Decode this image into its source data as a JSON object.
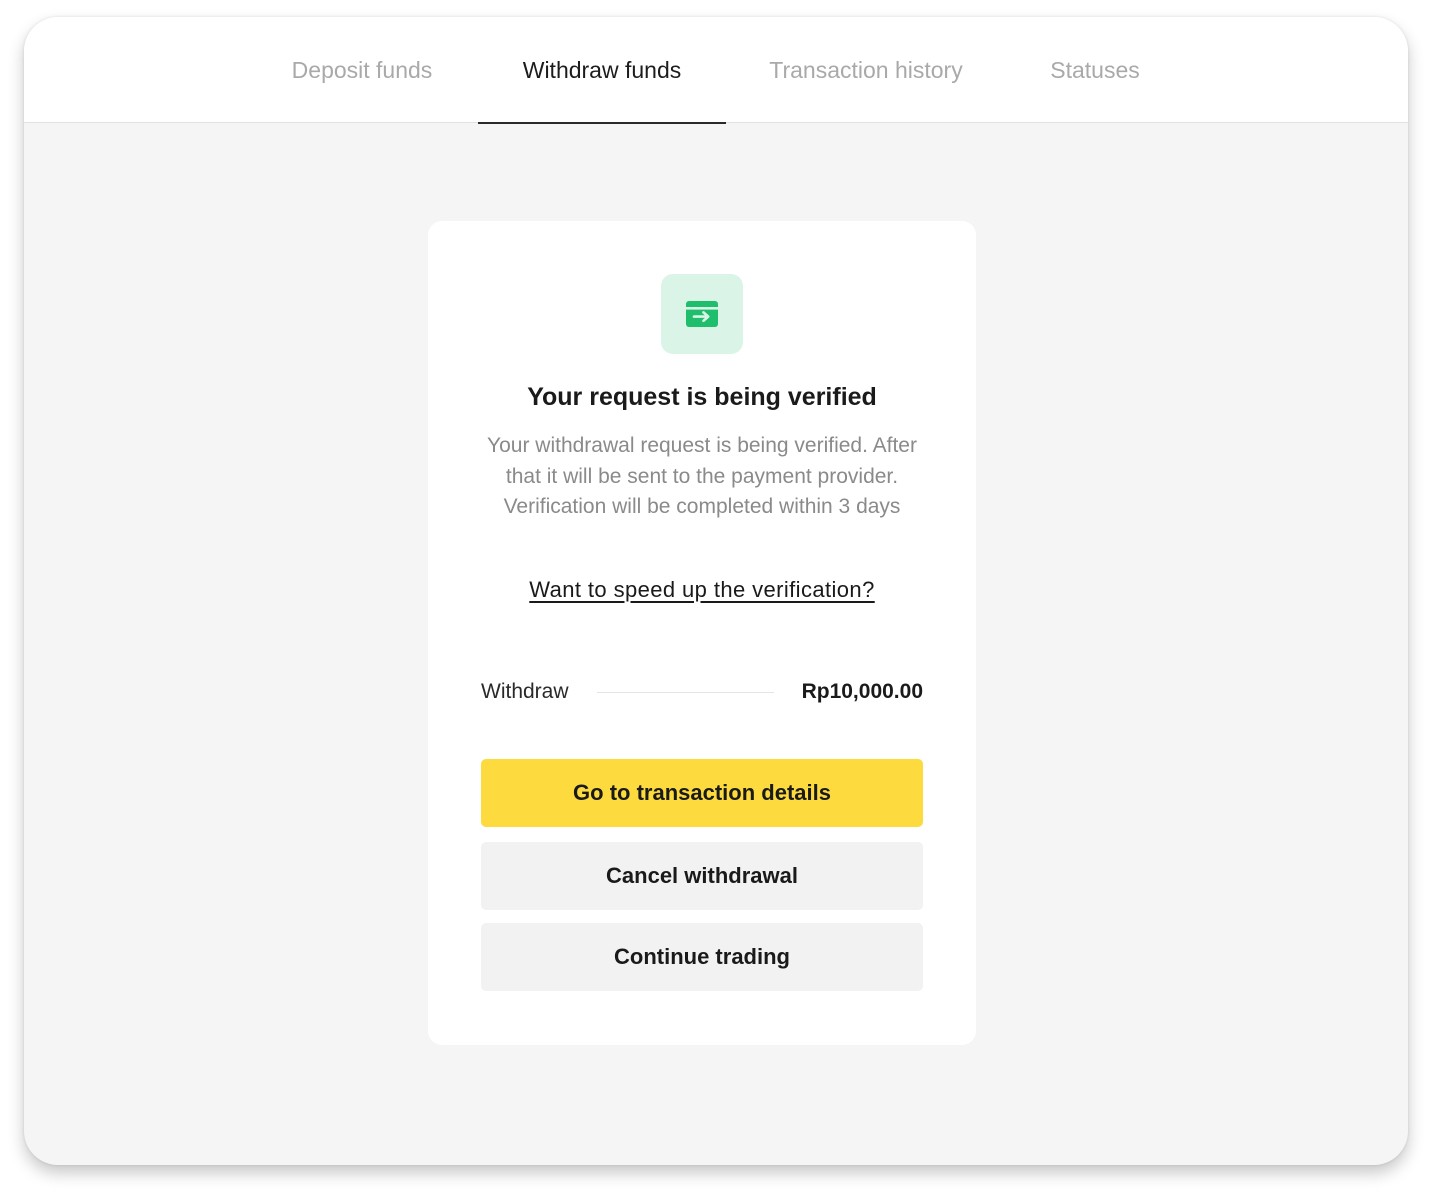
{
  "tabs": [
    {
      "label": "Deposit funds",
      "active": false
    },
    {
      "label": "Withdraw funds",
      "active": true
    },
    {
      "label": "Transaction history",
      "active": false
    },
    {
      "label": "Statuses",
      "active": false
    }
  ],
  "card": {
    "icon": "wallet-transfer-icon",
    "title": "Your request is being verified",
    "description": "Your withdrawal request is being verified. After that it will be sent to the payment provider. Verification will be completed within 3 days",
    "speed_up_link": "Want to speed up the verification?",
    "amount": {
      "label": "Withdraw",
      "value": "Rp10,000.00"
    },
    "buttons": {
      "details": "Go to transaction details",
      "cancel": "Cancel withdrawal",
      "continue": "Continue trading"
    }
  },
  "colors": {
    "accent_yellow": "#fddb3f",
    "icon_green": "#1fbe6d",
    "icon_bg": "#daf5e7",
    "page_bg": "#f5f5f5"
  }
}
